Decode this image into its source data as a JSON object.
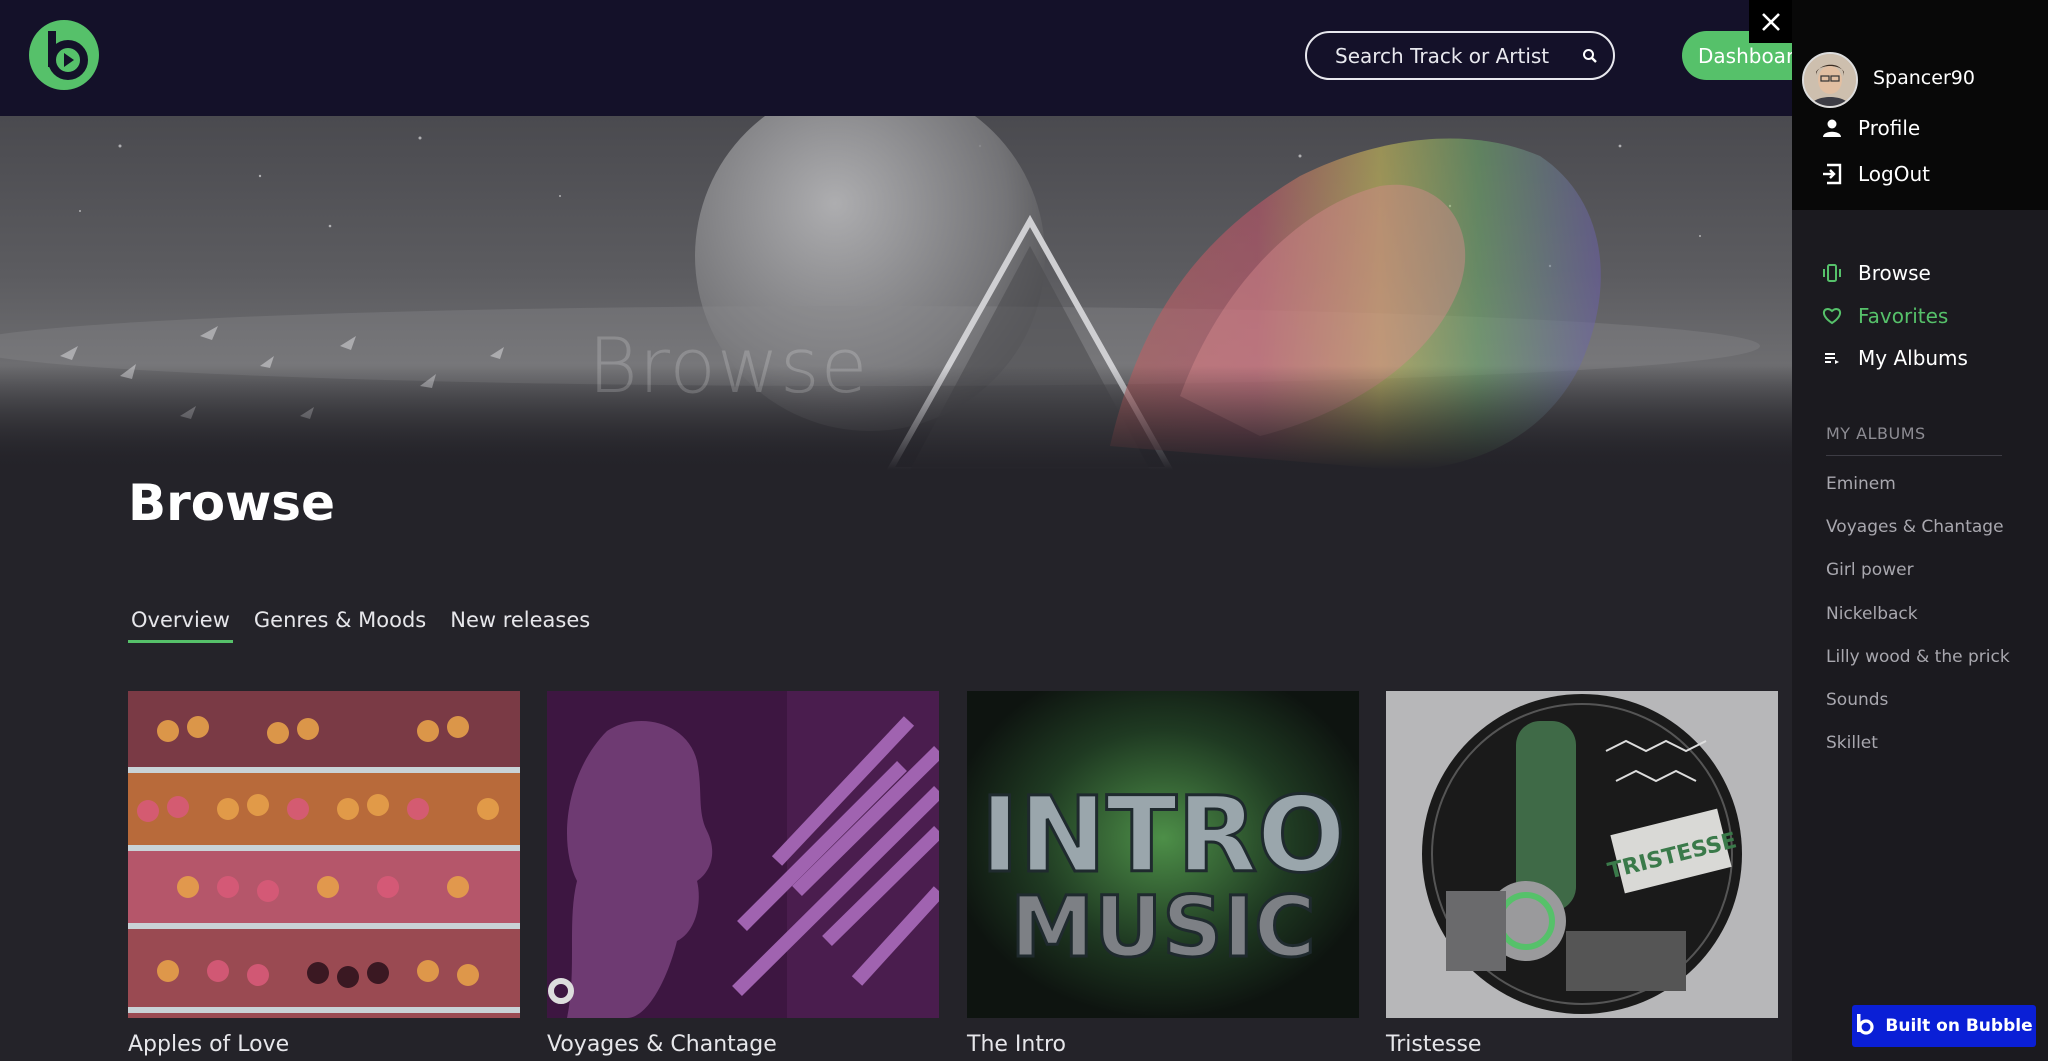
{
  "header": {
    "search": {
      "placeholder": "Search Track or Artist"
    },
    "dashboard_label": "Dashboard"
  },
  "hero": {
    "ghost_text": "Browse"
  },
  "main": {
    "title": "Browse",
    "tabs": [
      {
        "label": "Overview",
        "active": true
      },
      {
        "label": "Genres & Moods",
        "active": false
      },
      {
        "label": "New releases",
        "active": false
      }
    ],
    "albums": [
      {
        "title": "Apples of Love"
      },
      {
        "title": "Voyages & Chantage"
      },
      {
        "title": "The Intro",
        "cover_top": "INTRO",
        "cover_bottom": "MUSIC"
      },
      {
        "title": "Tristesse",
        "cover_text": "TRISTESSE"
      }
    ]
  },
  "panel": {
    "username": "Spancer90",
    "account_menu": [
      {
        "label": "Profile",
        "icon": "person-icon"
      },
      {
        "label": "LogOut",
        "icon": "logout-icon"
      }
    ],
    "nav": [
      {
        "label": "Browse",
        "icon": "vibrate-icon",
        "color": "#ffffff"
      },
      {
        "label": "Favorites",
        "icon": "heart-icon",
        "color": "#56c16a"
      },
      {
        "label": "My Albums",
        "icon": "playlist-icon",
        "color": "#ffffff"
      }
    ],
    "section_label": "MY ALBUMS",
    "my_albums": [
      "Eminem",
      "Voyages & Chantage",
      "Girl power",
      "Nickelback",
      "Lilly wood & the prick",
      "Sounds",
      "Skillet"
    ]
  },
  "badge": {
    "label": "Built on Bubble"
  },
  "colors": {
    "accent": "#56c16a",
    "topbar": "#141129",
    "background": "#242329",
    "bubble": "#0a1fd6"
  }
}
